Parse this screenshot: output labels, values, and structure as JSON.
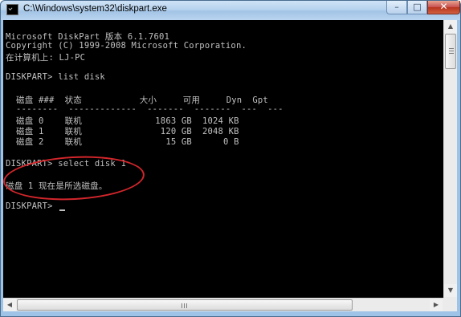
{
  "window": {
    "title": "C:\\Windows\\system32\\diskpart.exe",
    "buttons": {
      "minimize": "–",
      "maximize": "□",
      "close": "✕"
    }
  },
  "console": {
    "lines": [
      "Microsoft DiskPart 版本 6.1.7601",
      "Copyright (C) 1999-2008 Microsoft Corporation.",
      "在计算机上: LJ-PC",
      "DISKPART> list disk",
      "  磁盘 ###  状态           大小     可用     Dyn  Gpt",
      "  --------  -------------  -------  -------  ---  ---",
      "  磁盘 0    联机              1863 GB  1024 KB",
      "  磁盘 1    联机               120 GB  2048 KB",
      "  磁盘 2    联机                15 GB      0 B",
      "DISKPART> select disk 1",
      "磁盘 1 现在是所选磁盘。",
      "DISKPART> "
    ],
    "annotation_color": "#d3262b"
  },
  "colors": {
    "console_bg": "#000000",
    "console_text": "#c0c0c0",
    "frame": "#9ec3e6",
    "close_button": "#c75050"
  },
  "icons": {
    "app": "console-app-icon",
    "scroll_up": "scroll-up-arrow-icon",
    "scroll_down": "scroll-down-arrow-icon",
    "scroll_left": "scroll-left-arrow-icon",
    "scroll_right": "scroll-right-arrow-icon"
  }
}
